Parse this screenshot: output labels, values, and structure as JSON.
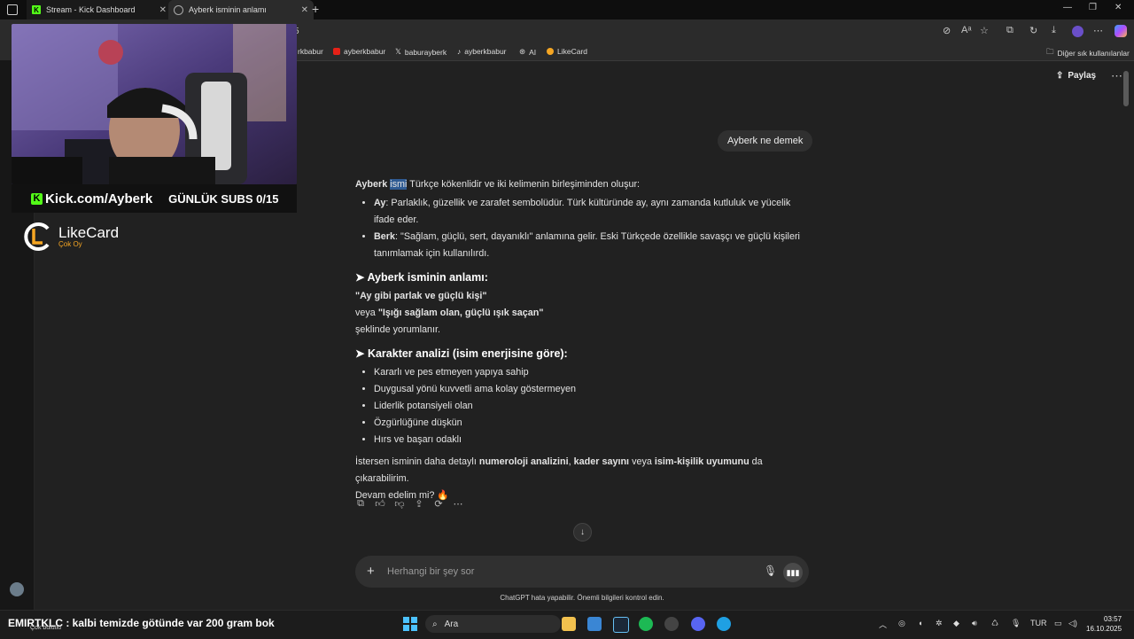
{
  "browser": {
    "tabs": [
      {
        "title": "Stream - Kick Dashboard"
      },
      {
        "title": "Ayberk isminin anlamı"
      }
    ],
    "address_fragment": "5",
    "bookmarks": [
      "rkbabur",
      "ayberkbabur",
      "baburayberk",
      "ayberkbabur",
      "AI",
      "LikeCard"
    ],
    "other_bookmarks": "Diğer sık kullanılanlar"
  },
  "overlay": {
    "kick_url": "Kick.com/Ayberk",
    "subs": "GÜNLÜK SUBS 0/15",
    "likecard_name": "LikeCard",
    "likecard_tagline": "Çok Oy",
    "ticker": "EMIRTKLC : kalbi temizde götünde var 200 gram bok",
    "ticker_sub": "Çok bulutlu"
  },
  "chat": {
    "share": "Paylaş",
    "user_message": "Ayberk ne demek",
    "intro_bold": "Ayberk",
    "intro_highlight": "ismi",
    "intro_rest": "Türkçe kökenlidir ve iki kelimenin birleşiminden oluşur:",
    "parts": [
      {
        "term": "Ay",
        "text": ": Parlaklık, güzellik ve zarafet sembolüdür. Türk kültüründe ay, aynı zamanda kutluluk ve yücelik ifade eder."
      },
      {
        "term": "Berk",
        "text": ": \"Sağlam, güçlü, sert, dayanıklı\" anlamına gelir. Eski Türkçede özellikle savaşçı ve güçlü kişileri tanımlamak için kullanılırdı."
      }
    ],
    "section1_title": "➤ Ayberk isminin anlamı:",
    "meaning1": "\"Ay gibi parlak ve güçlü kişi\"",
    "meaning_or": "veya",
    "meaning2": "\"Işığı sağlam olan, güçlü ışık saçan\"",
    "meaning_end": "şeklinde yorumlanır.",
    "section2_title": "➤ Karakter analizi (isim enerjisine göre):",
    "traits": [
      "Kararlı ve pes etmeyen yapıya sahip",
      "Duygusal yönü kuvvetli ama kolay göstermeyen",
      "Liderlik potansiyeli olan",
      "Özgürlüğüne düşkün",
      "Hırs ve başarı odaklı"
    ],
    "closing_1": "İstersen isminin daha detaylı",
    "closing_b1": "numeroloji analizini",
    "closing_2": ",",
    "closing_b2": "kader sayını",
    "closing_3": "veya",
    "closing_b3": "isim-kişilik uyumunu",
    "closing_4": "da çıkarabilirim.",
    "closing_question": "Devam edelim mi? 🔥",
    "input_placeholder": "Herhangi bir şey sor",
    "disclaimer": "ChatGPT hata yapabilir. Önemli bilgileri kontrol edin."
  },
  "taskbar": {
    "search": "Ara",
    "language": "TUR",
    "time": "03:57",
    "date": "16.10.2025"
  }
}
